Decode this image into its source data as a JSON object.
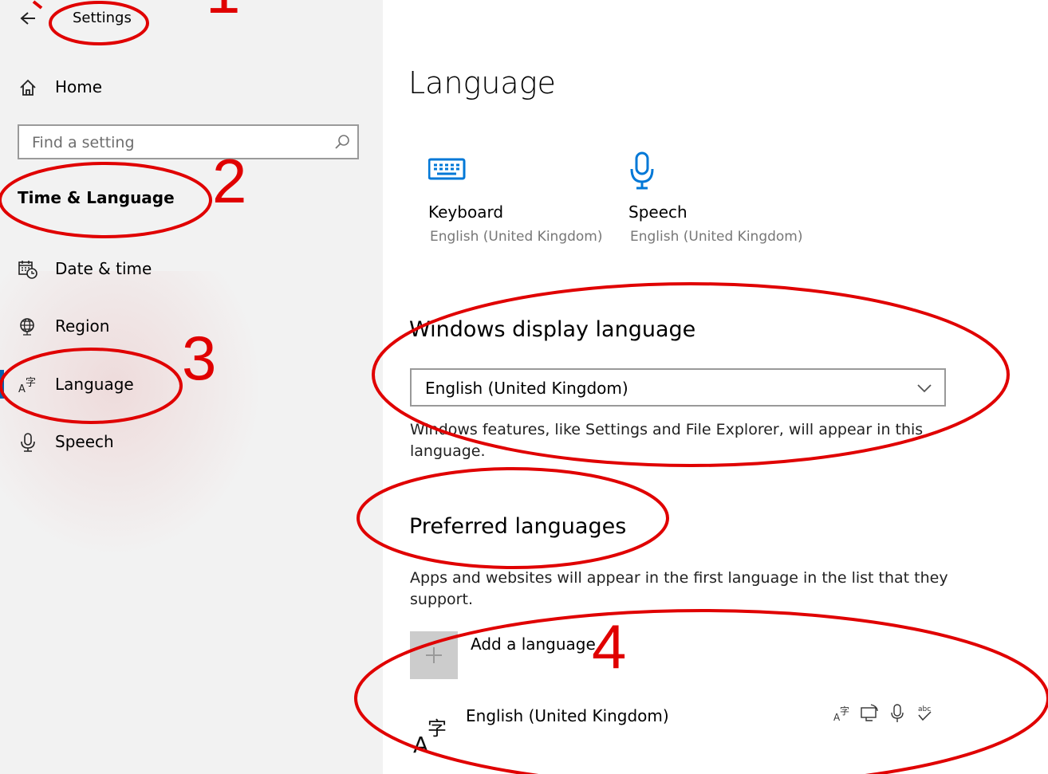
{
  "header": {
    "title": "Settings"
  },
  "sidebar": {
    "home_label": "Home",
    "search": {
      "placeholder": "Find a setting",
      "value": ""
    },
    "section_title": "Time & Language",
    "items": [
      {
        "label": "Date & time",
        "icon": "calendar-clock-icon"
      },
      {
        "label": "Region",
        "icon": "globe-icon"
      },
      {
        "label": "Language",
        "icon": "language-icon"
      },
      {
        "label": "Speech",
        "icon": "microphone-icon"
      }
    ]
  },
  "main": {
    "title": "Language",
    "tiles": [
      {
        "name": "Keyboard",
        "sub": "English (United Kingdom)",
        "icon": "keyboard-icon"
      },
      {
        "name": "Speech",
        "sub": "English (United Kingdom)",
        "icon": "microphone-icon"
      }
    ],
    "display_language": {
      "heading": "Windows display language",
      "selected": "English (United Kingdom)",
      "description": "Windows features, like Settings and File Explorer, will appear in this language."
    },
    "preferred": {
      "heading": "Preferred languages",
      "description": "Apps and websites will appear in the first language in the list that they support.",
      "add_label": "Add a language",
      "languages": [
        {
          "name": "English (United Kingdom)"
        }
      ]
    }
  },
  "annotations": {
    "marks": [
      "1",
      "2",
      "3",
      "4"
    ],
    "color": "#e00000"
  },
  "colors": {
    "accent": "#0078d7",
    "sidebar_bg": "#f2f2f2"
  }
}
